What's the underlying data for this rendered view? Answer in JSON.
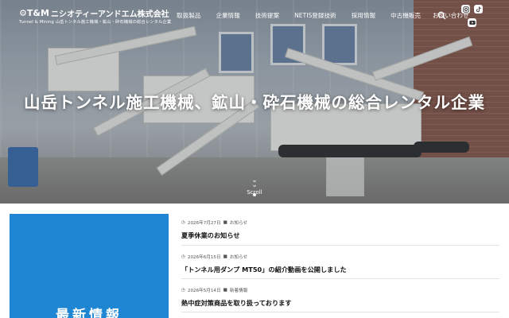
{
  "header": {
    "logo_mark": "T&M",
    "company_name": "ニシオティーアンドエム株式会社",
    "company_sub": "Tunnel & Mining 山岳トンネル施工機械・鉱山・砕石機械の総合レンタル企業"
  },
  "nav": {
    "items": [
      {
        "label": "取扱製品"
      },
      {
        "label": "企業情報"
      },
      {
        "label": "技術提案"
      },
      {
        "label": "NETIS登録技術"
      },
      {
        "label": "採用情報"
      },
      {
        "label": "中古機販売"
      },
      {
        "label": "お問い合わせ"
      }
    ],
    "search_icon": "search-icon",
    "social": [
      "instagram-icon",
      "tiktok-icon",
      "youtube-icon"
    ]
  },
  "hero": {
    "headline": "山岳トンネル施工機械、鉱山・砕石機械の総合レンタル企業",
    "scroll_label": "Scroll"
  },
  "news": {
    "section_title": "最新情報",
    "items": [
      {
        "date": "2026年7月27日",
        "category": "お知らせ",
        "title": "夏季休業のお知らせ"
      },
      {
        "date": "2026年6月15日",
        "category": "お知らせ",
        "title": "「トンネル用ダンプ MT50」の紹介動画を公開しました"
      },
      {
        "date": "2026年5月14日",
        "category": "新着情報",
        "title": "熱中症対策商品を取り扱っております"
      }
    ]
  },
  "colors": {
    "accent": "#1f86d4",
    "text": "#111111"
  }
}
